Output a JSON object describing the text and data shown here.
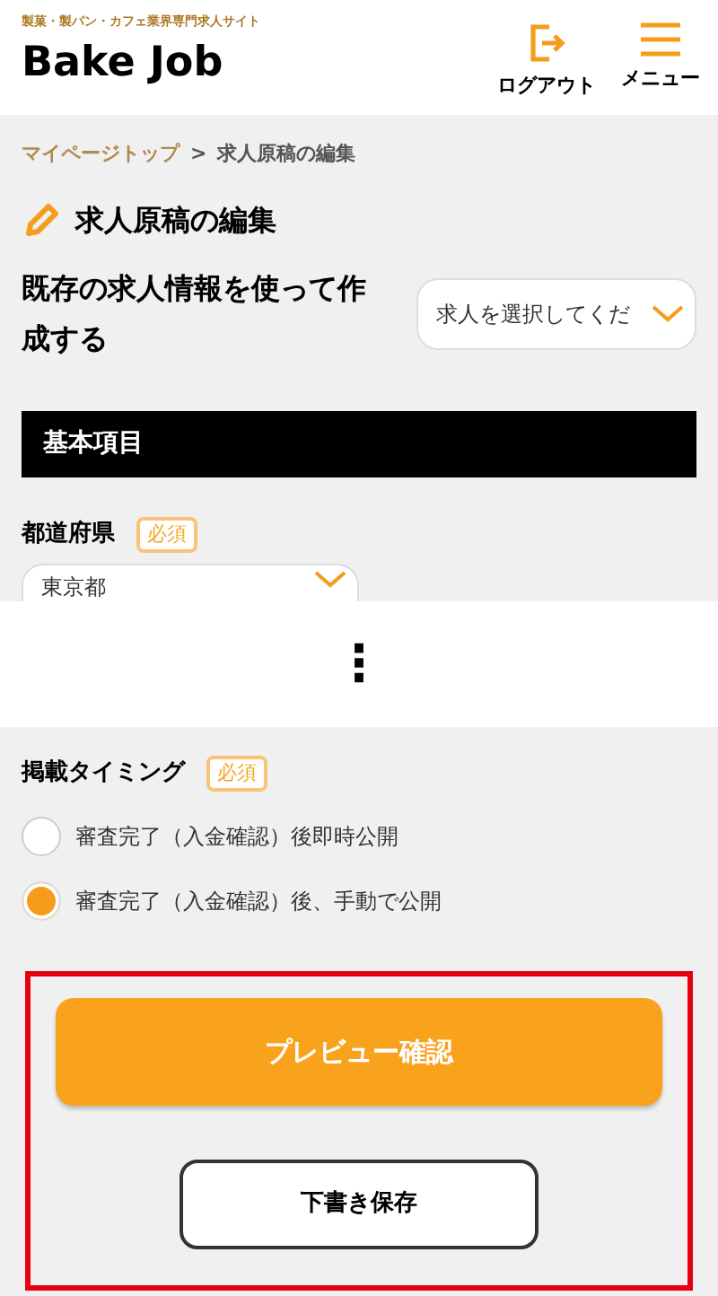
{
  "header": {
    "tagline": "製菓・製パン・カフェ業界専門求人サイト",
    "logo": "Bake Job",
    "actions": [
      {
        "kind": "logout",
        "label": "ログアウト"
      },
      {
        "kind": "menu",
        "label": "メニュー"
      }
    ]
  },
  "breadcrumb": [
    {
      "label": "マイページトップ",
      "link": true
    },
    {
      "label": "求人原稿の編集",
      "link": false
    }
  ],
  "breadcrumb_separator": ">",
  "page_title": "求人原稿の編集",
  "copy_from_existing": {
    "label": "既存の求人情報を使って作成する",
    "select_value": "求人を選択してくだ"
  },
  "section_heading": "基本項目",
  "prefecture": {
    "label": "都道府県",
    "badge": "必須",
    "value": "東京都"
  },
  "omission_mark": "⋮",
  "publish_timing": {
    "label": "掲載タイミング",
    "badge": "必須",
    "options": [
      {
        "label": "審査完了（入金確認）後即時公開",
        "selected": false
      },
      {
        "label": "審査完了（入金確認）後、手動で公開",
        "selected": true
      }
    ]
  },
  "buttons": [
    {
      "kind": "primary",
      "label": "プレビュー確認"
    },
    {
      "kind": "secondary",
      "label": "下書き保存"
    }
  ]
}
